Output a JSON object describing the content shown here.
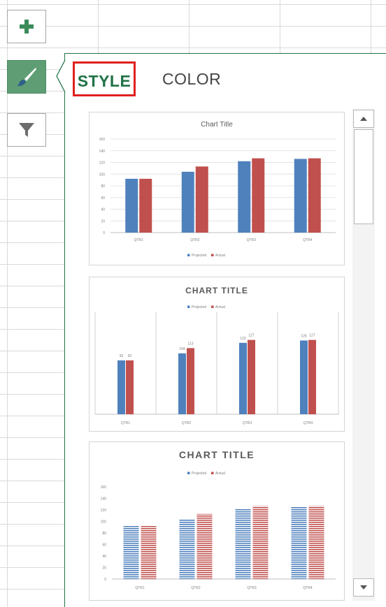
{
  "side_buttons": {
    "add": {
      "icon": "plus-icon"
    },
    "style": {
      "icon": "brush-icon"
    },
    "filter": {
      "icon": "funnel-icon"
    }
  },
  "pane": {
    "tabs": [
      {
        "label": "STYLE",
        "active": true
      },
      {
        "label": "COLOR",
        "active": false
      }
    ]
  },
  "styles": [
    {
      "title": "Chart Title"
    },
    {
      "title": "CHART TITLE"
    },
    {
      "title": "CHART TITLE"
    }
  ],
  "colors": {
    "accent": "#217346",
    "active_button": "#5f9e75",
    "selection": "#e02020",
    "series_blue": "#4f81bd",
    "series_red": "#c0504d"
  },
  "chart_data": [
    {
      "type": "bar",
      "title": "Chart Title",
      "categories": [
        "QTR1",
        "QTR2",
        "QTR3",
        "QTR4"
      ],
      "series": [
        {
          "name": "Projected",
          "values": [
            92,
            104,
            122,
            126
          ]
        },
        {
          "name": "Actual",
          "values": [
            92,
            113,
            127,
            127
          ]
        }
      ],
      "ylim": [
        0,
        160
      ],
      "yticks": [
        0,
        20,
        40,
        60,
        80,
        100,
        120,
        140,
        160
      ],
      "legend": "bottom",
      "grid": true
    },
    {
      "type": "bar",
      "title": "CHART TITLE",
      "categories": [
        "QTR1",
        "QTR2",
        "QTR3",
        "QTR4"
      ],
      "series": [
        {
          "name": "Projected",
          "values": [
            92,
            104,
            122,
            126
          ]
        },
        {
          "name": "Actual",
          "values": [
            92,
            113,
            127,
            127
          ]
        }
      ],
      "ylim": [
        0,
        160
      ],
      "legend": "top",
      "grid": false,
      "data_labels": true
    },
    {
      "type": "bar",
      "title": "CHART TITLE",
      "categories": [
        "QTR1",
        "QTR2",
        "QTR3",
        "QTR4"
      ],
      "series": [
        {
          "name": "Projected",
          "values": [
            92,
            104,
            122,
            126
          ]
        },
        {
          "name": "Actual",
          "values": [
            92,
            113,
            127,
            127
          ]
        }
      ],
      "ylim": [
        0,
        160
      ],
      "yticks": [
        0,
        20,
        40,
        60,
        80,
        100,
        120,
        140,
        160
      ],
      "legend": "top",
      "grid": false,
      "pattern": "horizontal-stripes"
    }
  ]
}
